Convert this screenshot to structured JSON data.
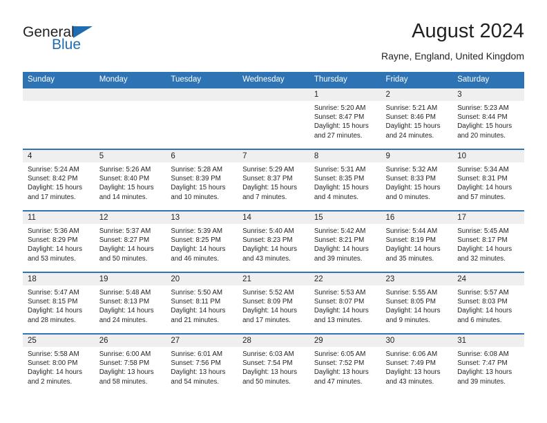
{
  "logo": {
    "word_one": "General",
    "word_two": "Blue",
    "triangle_color": "#1f6cb0",
    "text_color": "#231f20"
  },
  "header": {
    "title": "August 2024",
    "subtitle": "Rayne, England, United Kingdom"
  },
  "theme": {
    "header_blue": "#2e74b5",
    "daynum_band": "#efefef",
    "text": "#231f20"
  },
  "weekdays": [
    "Sunday",
    "Monday",
    "Tuesday",
    "Wednesday",
    "Thursday",
    "Friday",
    "Saturday"
  ],
  "weeks": [
    [
      {
        "day": "",
        "sunrise": "",
        "sunset": "",
        "daylight_1": "",
        "daylight_2": ""
      },
      {
        "day": "",
        "sunrise": "",
        "sunset": "",
        "daylight_1": "",
        "daylight_2": ""
      },
      {
        "day": "",
        "sunrise": "",
        "sunset": "",
        "daylight_1": "",
        "daylight_2": ""
      },
      {
        "day": "",
        "sunrise": "",
        "sunset": "",
        "daylight_1": "",
        "daylight_2": ""
      },
      {
        "day": "1",
        "sunrise": "Sunrise: 5:20 AM",
        "sunset": "Sunset: 8:47 PM",
        "daylight_1": "Daylight: 15 hours",
        "daylight_2": "and 27 minutes."
      },
      {
        "day": "2",
        "sunrise": "Sunrise: 5:21 AM",
        "sunset": "Sunset: 8:46 PM",
        "daylight_1": "Daylight: 15 hours",
        "daylight_2": "and 24 minutes."
      },
      {
        "day": "3",
        "sunrise": "Sunrise: 5:23 AM",
        "sunset": "Sunset: 8:44 PM",
        "daylight_1": "Daylight: 15 hours",
        "daylight_2": "and 20 minutes."
      }
    ],
    [
      {
        "day": "4",
        "sunrise": "Sunrise: 5:24 AM",
        "sunset": "Sunset: 8:42 PM",
        "daylight_1": "Daylight: 15 hours",
        "daylight_2": "and 17 minutes."
      },
      {
        "day": "5",
        "sunrise": "Sunrise: 5:26 AM",
        "sunset": "Sunset: 8:40 PM",
        "daylight_1": "Daylight: 15 hours",
        "daylight_2": "and 14 minutes."
      },
      {
        "day": "6",
        "sunrise": "Sunrise: 5:28 AM",
        "sunset": "Sunset: 8:39 PM",
        "daylight_1": "Daylight: 15 hours",
        "daylight_2": "and 10 minutes."
      },
      {
        "day": "7",
        "sunrise": "Sunrise: 5:29 AM",
        "sunset": "Sunset: 8:37 PM",
        "daylight_1": "Daylight: 15 hours",
        "daylight_2": "and 7 minutes."
      },
      {
        "day": "8",
        "sunrise": "Sunrise: 5:31 AM",
        "sunset": "Sunset: 8:35 PM",
        "daylight_1": "Daylight: 15 hours",
        "daylight_2": "and 4 minutes."
      },
      {
        "day": "9",
        "sunrise": "Sunrise: 5:32 AM",
        "sunset": "Sunset: 8:33 PM",
        "daylight_1": "Daylight: 15 hours",
        "daylight_2": "and 0 minutes."
      },
      {
        "day": "10",
        "sunrise": "Sunrise: 5:34 AM",
        "sunset": "Sunset: 8:31 PM",
        "daylight_1": "Daylight: 14 hours",
        "daylight_2": "and 57 minutes."
      }
    ],
    [
      {
        "day": "11",
        "sunrise": "Sunrise: 5:36 AM",
        "sunset": "Sunset: 8:29 PM",
        "daylight_1": "Daylight: 14 hours",
        "daylight_2": "and 53 minutes."
      },
      {
        "day": "12",
        "sunrise": "Sunrise: 5:37 AM",
        "sunset": "Sunset: 8:27 PM",
        "daylight_1": "Daylight: 14 hours",
        "daylight_2": "and 50 minutes."
      },
      {
        "day": "13",
        "sunrise": "Sunrise: 5:39 AM",
        "sunset": "Sunset: 8:25 PM",
        "daylight_1": "Daylight: 14 hours",
        "daylight_2": "and 46 minutes."
      },
      {
        "day": "14",
        "sunrise": "Sunrise: 5:40 AM",
        "sunset": "Sunset: 8:23 PM",
        "daylight_1": "Daylight: 14 hours",
        "daylight_2": "and 43 minutes."
      },
      {
        "day": "15",
        "sunrise": "Sunrise: 5:42 AM",
        "sunset": "Sunset: 8:21 PM",
        "daylight_1": "Daylight: 14 hours",
        "daylight_2": "and 39 minutes."
      },
      {
        "day": "16",
        "sunrise": "Sunrise: 5:44 AM",
        "sunset": "Sunset: 8:19 PM",
        "daylight_1": "Daylight: 14 hours",
        "daylight_2": "and 35 minutes."
      },
      {
        "day": "17",
        "sunrise": "Sunrise: 5:45 AM",
        "sunset": "Sunset: 8:17 PM",
        "daylight_1": "Daylight: 14 hours",
        "daylight_2": "and 32 minutes."
      }
    ],
    [
      {
        "day": "18",
        "sunrise": "Sunrise: 5:47 AM",
        "sunset": "Sunset: 8:15 PM",
        "daylight_1": "Daylight: 14 hours",
        "daylight_2": "and 28 minutes."
      },
      {
        "day": "19",
        "sunrise": "Sunrise: 5:48 AM",
        "sunset": "Sunset: 8:13 PM",
        "daylight_1": "Daylight: 14 hours",
        "daylight_2": "and 24 minutes."
      },
      {
        "day": "20",
        "sunrise": "Sunrise: 5:50 AM",
        "sunset": "Sunset: 8:11 PM",
        "daylight_1": "Daylight: 14 hours",
        "daylight_2": "and 21 minutes."
      },
      {
        "day": "21",
        "sunrise": "Sunrise: 5:52 AM",
        "sunset": "Sunset: 8:09 PM",
        "daylight_1": "Daylight: 14 hours",
        "daylight_2": "and 17 minutes."
      },
      {
        "day": "22",
        "sunrise": "Sunrise: 5:53 AM",
        "sunset": "Sunset: 8:07 PM",
        "daylight_1": "Daylight: 14 hours",
        "daylight_2": "and 13 minutes."
      },
      {
        "day": "23",
        "sunrise": "Sunrise: 5:55 AM",
        "sunset": "Sunset: 8:05 PM",
        "daylight_1": "Daylight: 14 hours",
        "daylight_2": "and 9 minutes."
      },
      {
        "day": "24",
        "sunrise": "Sunrise: 5:57 AM",
        "sunset": "Sunset: 8:03 PM",
        "daylight_1": "Daylight: 14 hours",
        "daylight_2": "and 6 minutes."
      }
    ],
    [
      {
        "day": "25",
        "sunrise": "Sunrise: 5:58 AM",
        "sunset": "Sunset: 8:00 PM",
        "daylight_1": "Daylight: 14 hours",
        "daylight_2": "and 2 minutes."
      },
      {
        "day": "26",
        "sunrise": "Sunrise: 6:00 AM",
        "sunset": "Sunset: 7:58 PM",
        "daylight_1": "Daylight: 13 hours",
        "daylight_2": "and 58 minutes."
      },
      {
        "day": "27",
        "sunrise": "Sunrise: 6:01 AM",
        "sunset": "Sunset: 7:56 PM",
        "daylight_1": "Daylight: 13 hours",
        "daylight_2": "and 54 minutes."
      },
      {
        "day": "28",
        "sunrise": "Sunrise: 6:03 AM",
        "sunset": "Sunset: 7:54 PM",
        "daylight_1": "Daylight: 13 hours",
        "daylight_2": "and 50 minutes."
      },
      {
        "day": "29",
        "sunrise": "Sunrise: 6:05 AM",
        "sunset": "Sunset: 7:52 PM",
        "daylight_1": "Daylight: 13 hours",
        "daylight_2": "and 47 minutes."
      },
      {
        "day": "30",
        "sunrise": "Sunrise: 6:06 AM",
        "sunset": "Sunset: 7:49 PM",
        "daylight_1": "Daylight: 13 hours",
        "daylight_2": "and 43 minutes."
      },
      {
        "day": "31",
        "sunrise": "Sunrise: 6:08 AM",
        "sunset": "Sunset: 7:47 PM",
        "daylight_1": "Daylight: 13 hours",
        "daylight_2": "and 39 minutes."
      }
    ]
  ]
}
